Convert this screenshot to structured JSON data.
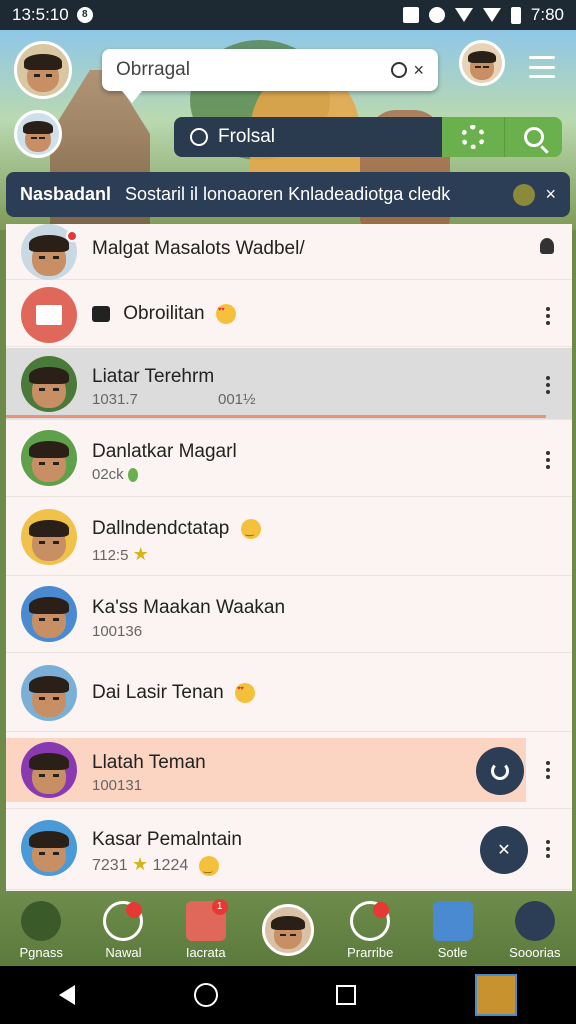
{
  "status_bar": {
    "time": "13:5:10",
    "time_right": "7:80",
    "notif_glyph": "8"
  },
  "header": {
    "search_text": "Obrragal",
    "search_qicon": "search-icon",
    "search_close": "×",
    "filter_text": "Frolsal",
    "banner_title": "Nasbadanl",
    "banner_message": "Sostaril il lonoaoren Knladeadiotga cledk",
    "banner_close": "×"
  },
  "chats": [
    {
      "name": "Malgat Masalots Wadbel/",
      "sub": "",
      "badge": true,
      "right_icon": "person-icon"
    },
    {
      "name": "Obroilitan",
      "sub": "",
      "emoji": "love",
      "prefix_icon": "thumbs-up-icon",
      "avatar_type": "mail"
    },
    {
      "name": "Liatar Terehrm",
      "sub": "1031.7",
      "sub2": "001½",
      "highlight": "gray"
    },
    {
      "name": "Danlatkar Magarl",
      "sub": "02ck",
      "sub_icon": "balloon-icon"
    },
    {
      "name": "Dallndendctatap",
      "sub": "112:5",
      "emoji": "smile",
      "sub_star": "★"
    },
    {
      "name": "Ka'ss Maakan Waakan",
      "sub": "100136"
    },
    {
      "name": "Dai Lasir Tenan",
      "emoji": "love"
    },
    {
      "name": "Llatah Teman",
      "sub": "100131",
      "highlight": "peach",
      "fab": "refresh"
    },
    {
      "name": "Kasar Pemalntain",
      "sub": "7231",
      "sub_star": "★",
      "sub_extra": "1224",
      "emoji_sub": "smile",
      "fab": "close"
    }
  ],
  "bottom_nav": [
    {
      "label": "Pgnass",
      "icon": "profile-icon"
    },
    {
      "label": "Nawal",
      "icon": "swords-icon",
      "badge": ""
    },
    {
      "label": "Iacrata",
      "icon": "star-icon",
      "badge": "1"
    },
    {
      "label": "",
      "icon": "center-avatar"
    },
    {
      "label": "Prarribe",
      "icon": "pencil-icon",
      "badge": ""
    },
    {
      "label": "Sotle",
      "icon": "image-icon"
    },
    {
      "label": "Sooorias",
      "icon": "camera-icon"
    }
  ],
  "colors": {
    "accent_green": "#6ab04c",
    "navy": "#2c3e55",
    "peach_highlight": "#fcd5c2",
    "gray_highlight": "#dcdcdc"
  }
}
